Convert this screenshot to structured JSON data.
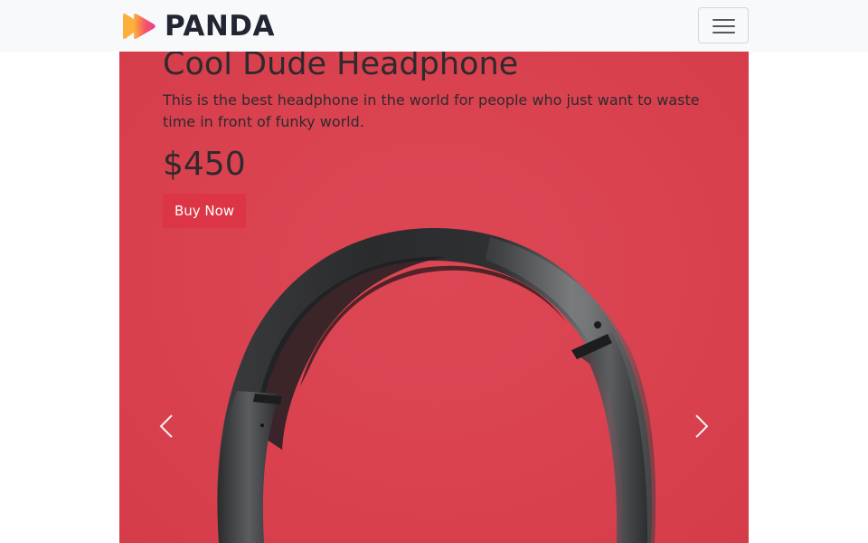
{
  "brand": {
    "name": "PANDA",
    "logo_icon": "play-logo-icon",
    "logo_colors": [
      "#fbb03b",
      "#f7495f",
      "#e9348f"
    ]
  },
  "navbar": {
    "toggler_icon": "hamburger-menu-icon"
  },
  "slide": {
    "title": "Cool Dude Headphone",
    "description": "This is the best headphone in the world for people who just want to waste time in front of funky world.",
    "price": "$450",
    "button_label": "Buy Now",
    "image_icon": "headphone-image"
  },
  "controls": {
    "prev_icon": "chevron-left-icon",
    "next_icon": "chevron-right-icon"
  },
  "colors": {
    "slide_background": "#d9414f",
    "button": "#dc3545",
    "navbar": "#f8f9fa",
    "text": "#2e2a2d"
  }
}
